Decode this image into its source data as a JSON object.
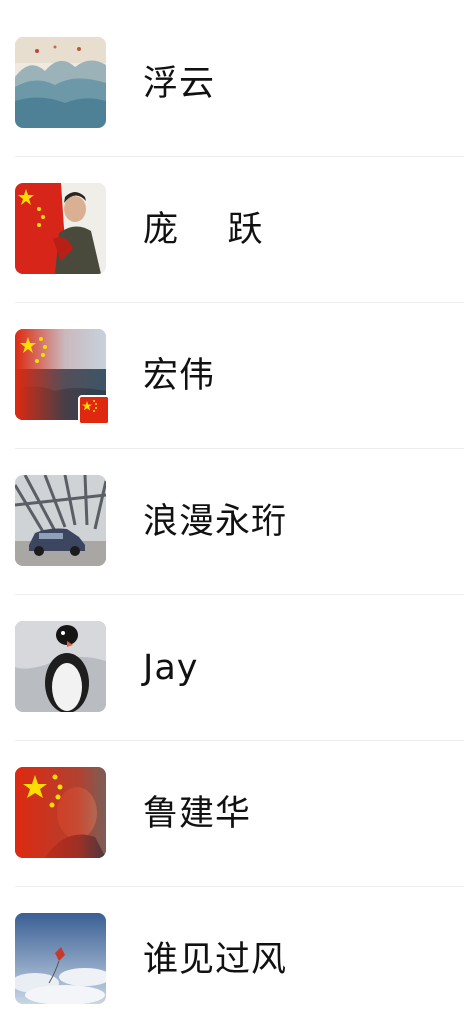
{
  "contacts": [
    {
      "name": "浮云",
      "avatar_icon": "landscape-painting-avatar"
    },
    {
      "name": "庞    跃",
      "avatar_icon": "man-with-flag-avatar"
    },
    {
      "name": "宏伟",
      "avatar_icon": "flag-sea-avatar",
      "badge_icon": "china-flag-badge-icon"
    },
    {
      "name": "浪漫永珩",
      "avatar_icon": "suv-car-avatar"
    },
    {
      "name": "Jay",
      "avatar_icon": "penguin-avatar"
    },
    {
      "name": "鲁建华",
      "avatar_icon": "flag-portrait-avatar"
    },
    {
      "name": "谁见过风",
      "avatar_icon": "kite-sky-avatar"
    }
  ],
  "colors": {
    "flag_red": "#de2910",
    "flag_yellow": "#ffde00",
    "divider": "#ececec",
    "text": "#111111"
  }
}
